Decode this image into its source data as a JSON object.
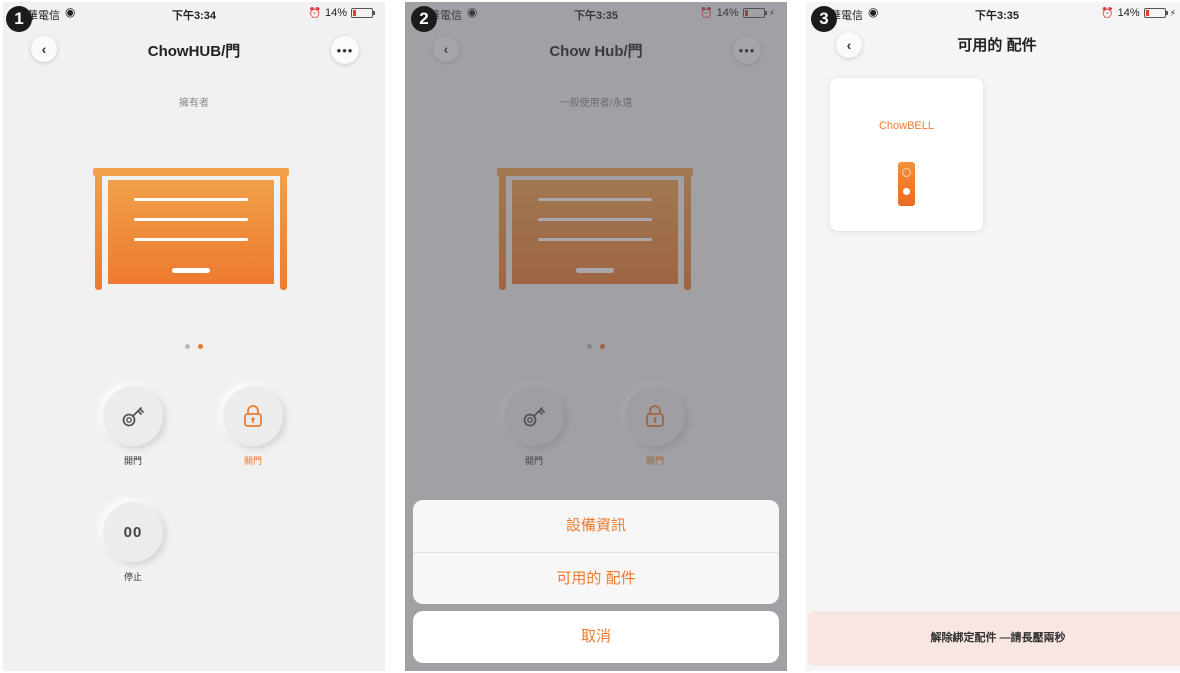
{
  "colors": {
    "accent": "#ef7a2e",
    "dim_overlay": "#50505a"
  },
  "screens": [
    {
      "step": "1",
      "status": {
        "carrier": "華電信",
        "time": "下午3:34",
        "battery": "14%"
      },
      "nav": {
        "back_icon": "chevron-left",
        "title": "ChowHUB/門",
        "more_icon": "ellipsis"
      },
      "role": "擁有者",
      "carousel": {
        "pages": 2,
        "active": 2
      },
      "controls": [
        {
          "label": "開門",
          "icon": "key-icon"
        },
        {
          "label": "關門",
          "icon": "lock-icon"
        },
        {
          "label": "停止",
          "icon": "pause-icon",
          "symbol": "00"
        }
      ]
    },
    {
      "step": "2",
      "status": {
        "carrier": "華電信",
        "time": "下午3:35",
        "battery": "14%"
      },
      "nav": {
        "back_icon": "chevron-left",
        "title": "Chow Hub/門",
        "more_icon": "ellipsis"
      },
      "role": "一般使用者/永遠",
      "carousel": {
        "pages": 2,
        "active": 2
      },
      "controls": [
        {
          "label": "開門",
          "icon": "key-icon"
        },
        {
          "label": "關門",
          "icon": "lock-icon"
        }
      ],
      "action_sheet": {
        "options": [
          "設備資訊",
          "可用的 配件"
        ],
        "cancel": "取消"
      }
    },
    {
      "step": "3",
      "status": {
        "carrier": "華電信",
        "time": "下午3:35",
        "battery": "14%"
      },
      "nav": {
        "back_icon": "chevron-left",
        "title": "可用的 配件"
      },
      "accessory": {
        "name": "ChowBELL",
        "icon": "doorbell-icon"
      },
      "unbind_hint": "解除綁定配件 —請長壓兩秒"
    }
  ]
}
